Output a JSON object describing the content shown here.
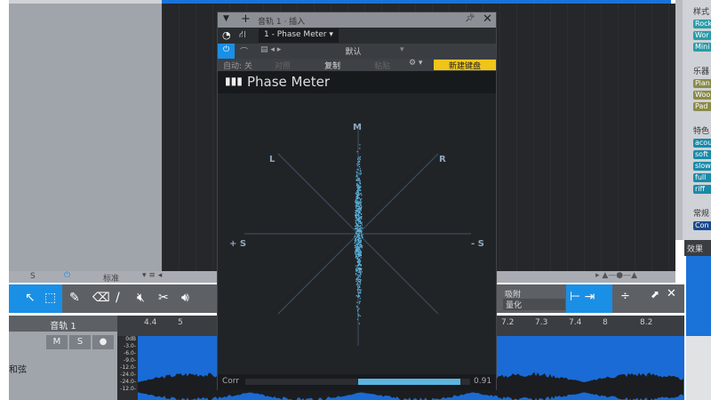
{
  "right_panel": {
    "sections": [
      {
        "title": "样式",
        "tags": [
          "Rock",
          "Wor",
          "Mini"
        ],
        "color": "#2a9ca8"
      },
      {
        "title": "乐器",
        "tags": [
          "Pian",
          "Woo",
          "Pad"
        ],
        "color": "#8a8a4a"
      },
      {
        "title": "特色",
        "tags": [
          "acou",
          "soft",
          "slow",
          "full",
          "riff"
        ],
        "color": "#1a8aa8"
      },
      {
        "title": "常规",
        "tags": [
          "Con"
        ],
        "color": "#1a4a90"
      }
    ],
    "effects_tab": "效果"
  },
  "bottom_row": {
    "solo": "S",
    "mode": "标准"
  },
  "toolbar": {
    "snap_label": "吸附",
    "quantize": "量化"
  },
  "track": {
    "name": "音轨 1",
    "mute": "M",
    "solo": "S",
    "chord_label": "和弦"
  },
  "ruler": {
    "ticks": [
      "4.4",
      "5",
      "7.2",
      "7.3",
      "7.4",
      "8",
      "8.2"
    ]
  },
  "db_scale": [
    "0dB",
    "-3.0-",
    "-6.0-",
    "-9.0-",
    "-12.0-",
    "-24.0-",
    "-24.0-",
    "-12.0-"
  ],
  "plugin": {
    "title": "音轨 1 · 插入",
    "plugin_select": "1 - Phase Meter",
    "preset": "默认",
    "auto": "自动: 关",
    "compare": "对照",
    "copy": "复制",
    "paste": "粘贴",
    "new_keyboard": "新建键盘",
    "name": "Phase Meter",
    "labels": {
      "m": "M",
      "l": "L",
      "r": "R",
      "plus_s": "+ S",
      "minus_s": "- S"
    },
    "corr_label": "Corr",
    "corr_value": "0.91",
    "corr": 0.91,
    "accent": "#5ab4e0",
    "new_keyboard_color": "#f0c419"
  }
}
